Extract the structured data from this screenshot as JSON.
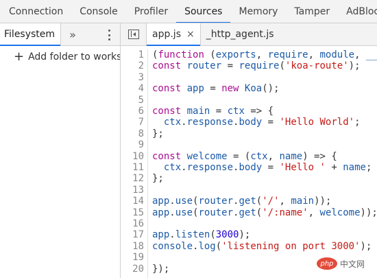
{
  "top_tabs": [
    "Connection",
    "Console",
    "Profiler",
    "Sources",
    "Memory",
    "Tamper",
    "AdBlock"
  ],
  "active_top_tab": "Sources",
  "navigator": {
    "tab_label": "Filesystem",
    "more_label": "»",
    "add_folder_label": "Add folder to worksp"
  },
  "editor": {
    "files": [
      {
        "name": "app.js",
        "active": true,
        "close": "×"
      },
      {
        "name": "_http_agent.js",
        "active": false
      }
    ],
    "lines": [
      "1",
      "2",
      "3",
      "4",
      "5",
      "6",
      "7",
      "8",
      "9",
      "10",
      "11",
      "12",
      "13",
      "14",
      "15",
      "16",
      "17",
      "18",
      "19",
      "20"
    ],
    "code": [
      "(function (exports, require, module, __f",
      "const router = require('koa-route');",
      "",
      "const app = new Koa();",
      "",
      "const main = ctx => {",
      "  ctx.response.body = 'Hello World';",
      "};",
      "",
      "const welcome = (ctx, name) => {",
      "  ctx.response.body = 'Hello ' + name;",
      "};",
      "",
      "app.use(router.get('/', main));",
      "app.use(router.get('/:name', welcome));",
      "",
      "app.listen(3000);",
      "console.log('listening on port 3000');",
      "",
      "});"
    ]
  },
  "watermark": {
    "logo": "php",
    "text": "中文网"
  }
}
